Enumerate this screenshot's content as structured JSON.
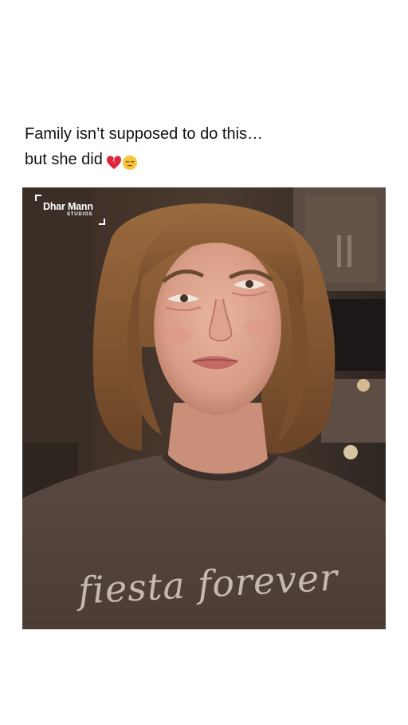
{
  "post": {
    "caption_line1": "Family isn’t supposed to do this…",
    "caption_line2": "but she did",
    "caption_emojis": [
      "broken-heart-icon",
      "pensive-face-icon"
    ]
  },
  "media": {
    "logo_brand": "Dhar Mann",
    "logo_sub": "STUDIOS",
    "shirt_text": "fiesta forever"
  },
  "colors": {
    "background": "#ffffff",
    "caption_text": "#111111",
    "logo": "#ffffff"
  }
}
